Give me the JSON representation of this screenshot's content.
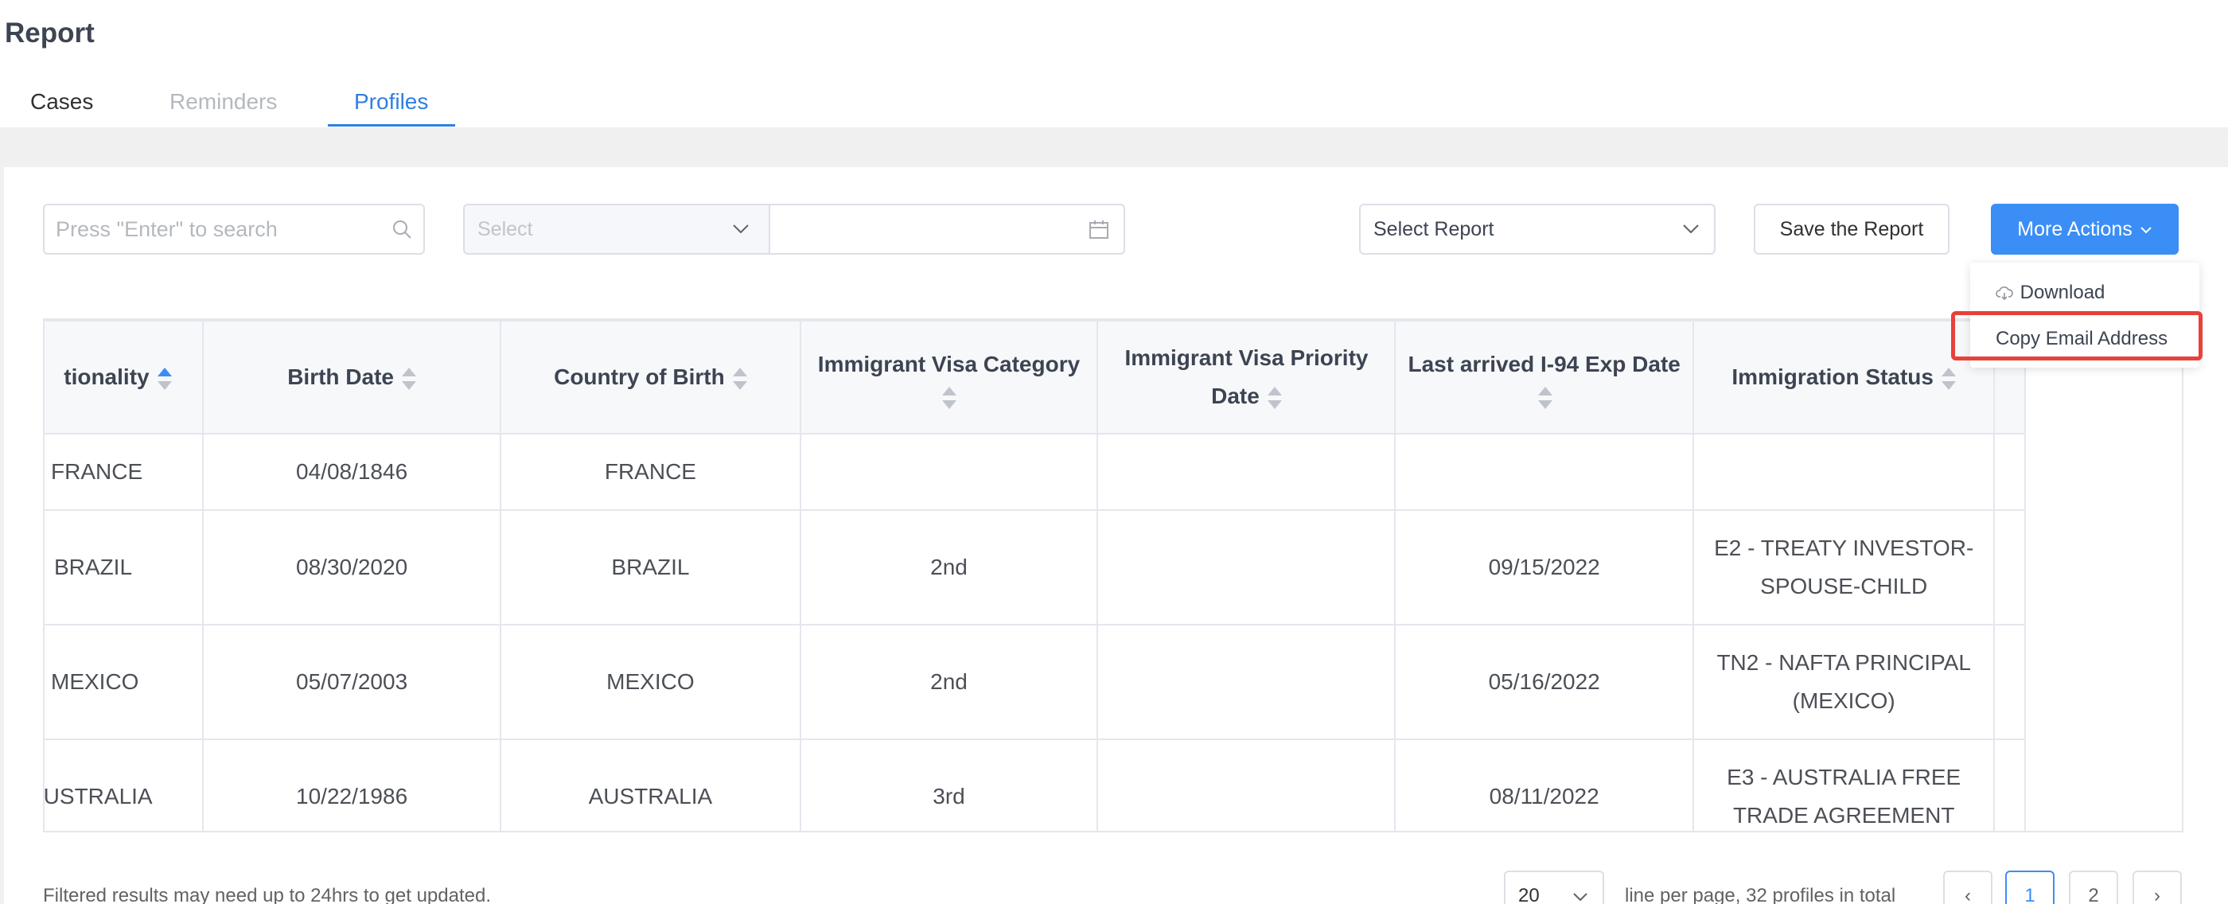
{
  "page": {
    "title": "Report"
  },
  "tabs": [
    {
      "label": "Cases",
      "state": "normal"
    },
    {
      "label": "Reminders",
      "state": "disabled"
    },
    {
      "label": "Profiles",
      "state": "active"
    }
  ],
  "filters": {
    "search_placeholder": "Press \"Enter\" to search",
    "select_placeholder": "Select",
    "date_value": "",
    "report_select_label": "Select Report"
  },
  "actions": {
    "save_label": "Save the Report",
    "more_label": "More Actions",
    "dropdown": [
      {
        "label": "Download",
        "icon": "cloud-download-icon"
      },
      {
        "label": "Copy Email Address"
      }
    ]
  },
  "table": {
    "columns": [
      {
        "label": "Nationality",
        "visible_label": "tionality",
        "sort": "asc"
      },
      {
        "label": "Birth Date",
        "sort": "none"
      },
      {
        "label": "Country of Birth",
        "sort": "none"
      },
      {
        "label": "Immigrant Visa Category",
        "sort": "none"
      },
      {
        "label": "Immigrant Visa Priority Date",
        "sort": "none"
      },
      {
        "label": "Last arrived I-94 Exp Date",
        "sort": "none"
      },
      {
        "label": "Immigration Status",
        "sort": "none"
      }
    ],
    "rows": [
      [
        "FRANCE",
        "04/08/1846",
        "FRANCE",
        "",
        "",
        "",
        ""
      ],
      [
        "BRAZIL",
        "08/30/2020",
        "BRAZIL",
        "2nd",
        "",
        "09/15/2022",
        "E2 - TREATY INVESTOR-SPOUSE-CHILD"
      ],
      [
        "MEXICO",
        "05/07/2003",
        "MEXICO",
        "2nd",
        "",
        "05/16/2022",
        "TN2 - NAFTA PRINCIPAL (MEXICO)"
      ],
      [
        "AUSTRALIA",
        "10/22/1986",
        "AUSTRALIA",
        "3rd",
        "",
        "08/11/2022",
        "E3 - AUSTRALIA FREE TRADE AGREEMENT"
      ]
    ]
  },
  "footer": {
    "note": "Filtered results may need up to 24hrs to get updated.",
    "per_page_value": "20",
    "per_page_text": "line per page, 32 profiles in total",
    "prev_symbol": "‹",
    "pages": [
      "1",
      "2"
    ],
    "current_page": "1",
    "next_symbol": "›"
  },
  "colors": {
    "accent": "#3a8ef6",
    "highlight": "#e8413a"
  }
}
